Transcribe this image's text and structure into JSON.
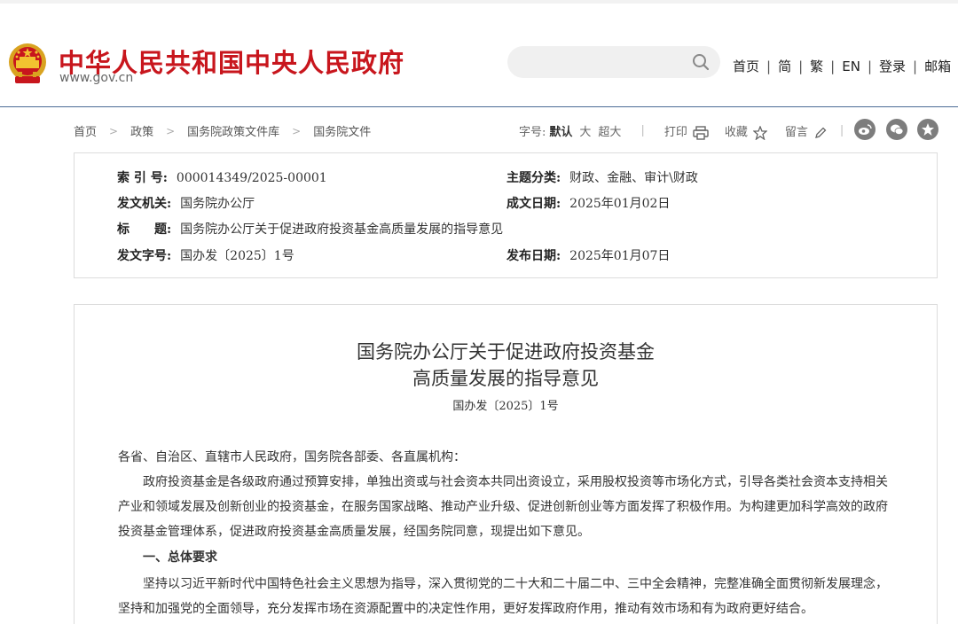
{
  "header": {
    "site_title": "中华人民共和国中央人民政府",
    "site_url": "www.gov.cn",
    "search_placeholder": "",
    "nav": [
      "首页",
      "简",
      "繁",
      "EN",
      "登录",
      "邮箱"
    ]
  },
  "breadcrumb": [
    "首页",
    "政策",
    "国务院政策文件库",
    "国务院文件"
  ],
  "tools": {
    "font_label": "字号:",
    "font_default": "默认",
    "font_large": "大",
    "font_xlarge": "超大",
    "print": "打印",
    "favorite": "收藏",
    "comment": "留言"
  },
  "meta": {
    "index_key": "索 引 号:",
    "index_val": "000014349/2025-00001",
    "category_key": "主题分类:",
    "category_val": "财政、金融、审计\\财政",
    "issuer_key": "发文机关:",
    "issuer_val": "国务院办公厅",
    "written_key": "成文日期:",
    "written_val": "2025年01月02日",
    "title_key": "标　　题:",
    "title_val": "国务院办公厅关于促进政府投资基金高质量发展的指导意见",
    "docno_key": "发文字号:",
    "docno_val": "国办发〔2025〕1号",
    "published_key": "发布日期:",
    "published_val": "2025年01月07日"
  },
  "document": {
    "title_line1": "国务院办公厅关于促进政府投资基金",
    "title_line2": "高质量发展的指导意见",
    "doc_number": "国办发〔2025〕1号",
    "salutation": "各省、自治区、直辖市人民政府，国务院各部委、各直属机构：",
    "para1": "政府投资基金是各级政府通过预算安排，单独出资或与社会资本共同出资设立，采用股权投资等市场化方式，引导各类社会资本支持相关产业和领域发展及创新创业的投资基金，在服务国家战略、推动产业升级、促进创新创业等方面发挥了积极作用。为构建更加科学高效的政府投资基金管理体系，促进政府投资基金高质量发展，经国务院同意，现提出如下意见。",
    "section1": "一、总体要求",
    "para2": "坚持以习近平新时代中国特色社会主义思想为指导，深入贯彻党的二十大和二十届二中、三中全会精神，完整准确全面贯彻新发展理念，坚持和加强党的全面领导，充分发挥市场在资源配置中的决定性作用，更好发挥政府作用，推动有效市场和有为政府更好结合。"
  },
  "colors": {
    "brand_red": "#c8161d",
    "rule_blue": "#4a6a96",
    "emblem_gold": "#f2c230"
  }
}
